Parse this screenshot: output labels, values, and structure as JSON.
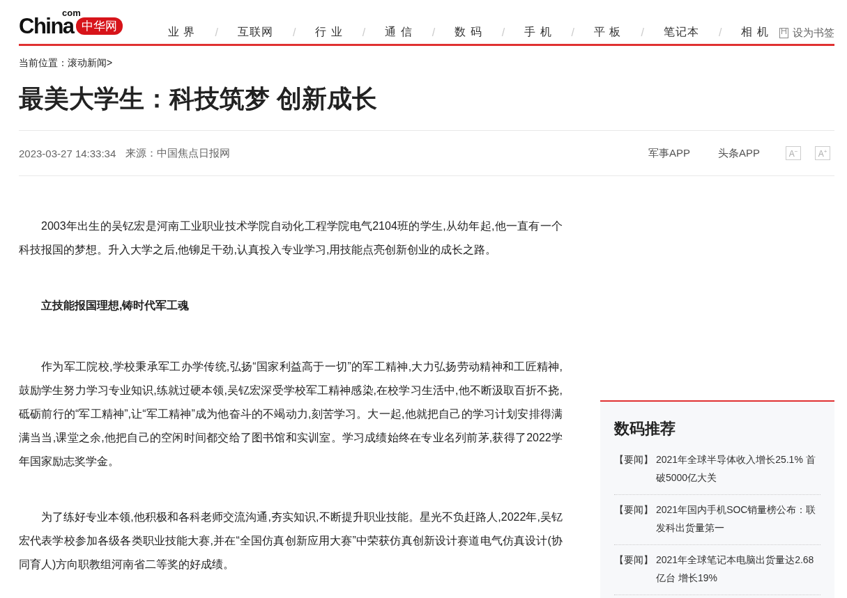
{
  "logo": {
    "word": "China",
    "suffix": "com",
    "badge": "中华网"
  },
  "nav": [
    {
      "label": "业 界"
    },
    {
      "label": "互联网"
    },
    {
      "label": "行 业"
    },
    {
      "label": "通 信"
    },
    {
      "label": "数 码"
    },
    {
      "label": "手 机"
    },
    {
      "label": "平 板"
    },
    {
      "label": "笔记本"
    },
    {
      "label": "相 机"
    }
  ],
  "nav_separator": "/",
  "bookmark": "设为书签",
  "breadcrumb": {
    "label": "当前位置：",
    "link": "滚动新闻",
    "arrow": ">"
  },
  "article": {
    "title": "最美大学生：科技筑梦 创新成长",
    "datetime": "2023-03-27 14:33:34",
    "source": "来源：中国焦点日报网",
    "app_links": [
      "军事APP",
      "头条APP"
    ],
    "font_buttons": [
      {
        "label": "A",
        "sign": "−"
      },
      {
        "label": "A",
        "sign": "+"
      }
    ],
    "body": [
      {
        "kind": "paragraph",
        "text": "2003年出生的吴钇宏是河南工业职业技术学院自动化工程学院电气2104班的学生,从幼年起,他一直有一个科技报国的梦想。升入大学之后,他铆足干劲,认真投入专业学习,用技能点亮创新创业的成长之路。"
      },
      {
        "kind": "heading",
        "text": "立技能报国理想,铸时代军工魂"
      },
      {
        "kind": "paragraph",
        "text": "作为军工院校,学校秉承军工办学传统,弘扬“国家利益高于一切”的军工精神,大力弘扬劳动精神和工匠精神,鼓励学生努力学习专业知识,练就过硬本领,吴钇宏深受学校军工精神感染,在校学习生活中,他不断汲取百折不挠,砥砺前行的“军工精神”,让“军工精神”成为他奋斗的不竭动力,刻苦学习。大一起,他就把自己的学习计划安排得满满当当,课堂之余,他把自己的空闲时间都交给了图书馆和实训室。学习成绩始终在专业名列前茅,获得了2022学年国家励志奖学金。"
      },
      {
        "kind": "paragraph",
        "text": "为了练好专业本领,他积极和各科老师交流沟通,夯实知识,不断提升职业技能。星光不负赶路人,2022年,吴钇宏代表学校参加各级各类职业技能大赛,并在“全国仿真创新应用大赛”中荣获仿真创新设计赛道电气仿真设计(协同育人)方向职教组河南省二等奖的好成绩。"
      }
    ]
  },
  "sidebar": {
    "title": "数码推荐",
    "items": [
      {
        "tag": "【要闻】",
        "title": "2021年全球半导体收入增长25.1% 首破5000亿大关"
      },
      {
        "tag": "【要闻】",
        "title": "2021年国内手机SOC销量榜公布：联发科出货量第一"
      },
      {
        "tag": "【要闻】",
        "title": "2021年全球笔记本电脑出货量达2.68亿台 增长19%"
      }
    ]
  }
}
